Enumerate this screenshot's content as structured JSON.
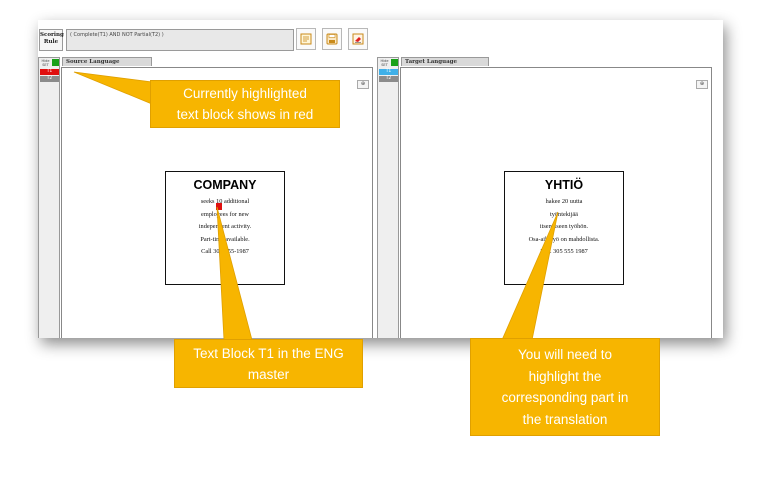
{
  "toolbar": {
    "scoring_label": "Scoring Rule",
    "rule_text": "( Complete(T1) AND NOT Partial(T2) )",
    "buttons": [
      {
        "name": "report-icon"
      },
      {
        "name": "save-icon"
      },
      {
        "name": "eraser-icon"
      }
    ]
  },
  "source_panel": {
    "side_header": "Hide SET",
    "blocks": [
      {
        "label": "T1",
        "color": "#e01010"
      },
      {
        "label": "T2",
        "color": "#8c8c8c"
      }
    ],
    "tab_label": "Source Language",
    "zoom_icon": "zoom-icon",
    "ad": {
      "title": "COMPANY",
      "lines": [
        "seeks 10 additional",
        "employees for new",
        "independent activity.",
        "Part-time available.",
        "Call 305-555-1987"
      ]
    }
  },
  "target_panel": {
    "side_header": "Hide SET",
    "blocks": [
      {
        "label": "T1",
        "color": "#3fb0e8"
      },
      {
        "label": "T2",
        "color": "#8c8c8c"
      }
    ],
    "tab_label": "Target Language",
    "zoom_icon": "zoom-icon",
    "ad": {
      "title": "YHTIÖ",
      "lines": [
        "hakee 20 uutta",
        "työntekijää",
        "itsenäiseen työhön.",
        "Osa-aikatyö on mahdollista.",
        "Puh. 305 555 1987"
      ]
    }
  },
  "callouts": {
    "highlight": [
      "Currently highlighted",
      "text block shows in red"
    ],
    "t1": [
      "Text Block T1 in the ENG",
      "master"
    ],
    "translation": [
      "You will need to",
      "highlight the",
      "corresponding part in",
      "the translation"
    ]
  },
  "colors": {
    "callout": "#f7b500",
    "highlight": "#e01010",
    "status_green": "#19a119"
  }
}
